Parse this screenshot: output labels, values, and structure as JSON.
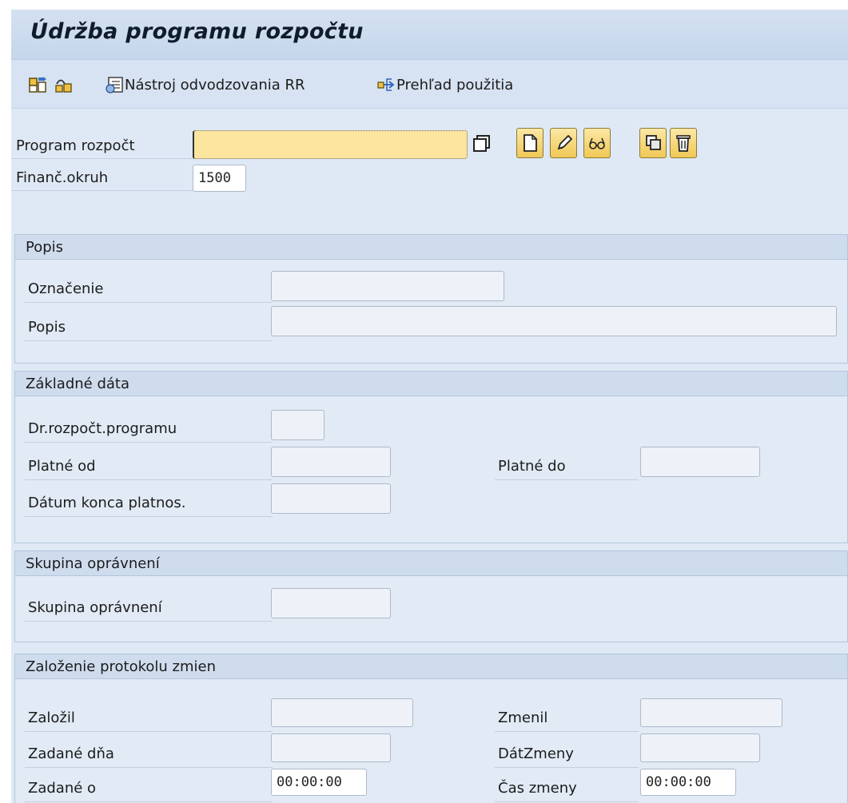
{
  "title": "Údržba programu rozpočtu",
  "toolbar": {
    "derivation_tool_label": "Nástroj odvodzovania RR",
    "where_used_label": "Prehľad použitia"
  },
  "header_fields": {
    "program_label": "Program rozpočt",
    "program_value": "",
    "fm_area_label": "Finanč.okruh",
    "fm_area_value": "1500"
  },
  "section_popis": {
    "title": "Popis",
    "oznacenie_label": "Označenie",
    "oznacenie_value": "",
    "popis_label": "Popis",
    "popis_value": ""
  },
  "section_basic": {
    "title": "Základné dáta",
    "program_type_label": "Dr.rozpočt.programu",
    "program_type_value": "",
    "valid_from_label": "Platné od",
    "valid_from_value": "",
    "valid_to_label": "Platné do",
    "valid_to_value": "",
    "end_date_label": "Dátum konca platnos.",
    "end_date_value": ""
  },
  "section_auth": {
    "title": "Skupina oprávnení",
    "group_label": "Skupina oprávnení",
    "group_value": ""
  },
  "section_log": {
    "title": "Založenie protokolu zmien",
    "created_by_label": "Založil",
    "created_by_value": "",
    "created_on_label": "Zadané dňa",
    "created_on_value": "",
    "created_at_label": "Zadané o",
    "created_at_value": "00:00:00",
    "changed_by_label": "Zmenil",
    "changed_by_value": "",
    "changed_on_label": "DátZmeny",
    "changed_on_value": "",
    "changed_at_label": "Čas zmeny",
    "changed_at_value": "00:00:00"
  },
  "icons": [
    "other-object-icon",
    "display-change-icon",
    "derivation-tool-icon",
    "where-used-icon",
    "copy-icon",
    "create-icon",
    "change-icon",
    "display-icon",
    "copy-from-icon",
    "delete-icon"
  ],
  "colors": {
    "required_field": "#fbe59f",
    "background": "#dfe9f5",
    "button": "#f1c855"
  }
}
